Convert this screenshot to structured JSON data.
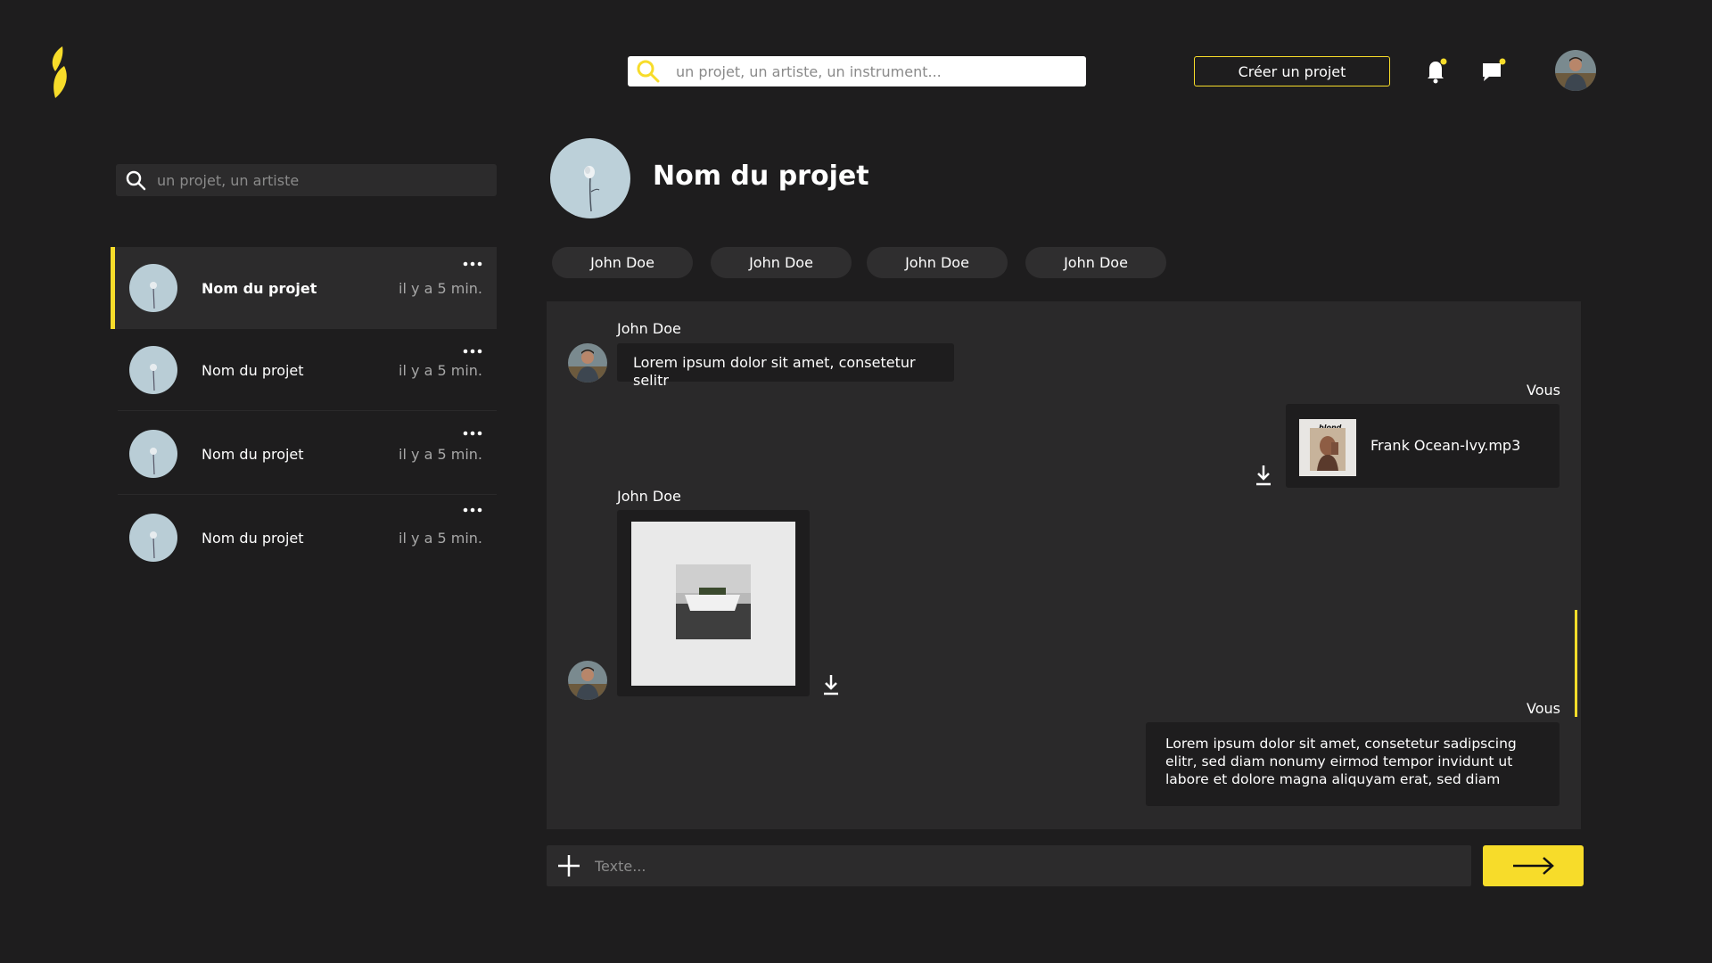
{
  "header": {
    "search_placeholder": "un projet, un artiste, un instrument...",
    "create_label": "Créer un projet"
  },
  "sidebar": {
    "search_placeholder": "un projet, un artiste",
    "items": [
      {
        "name": "Nom du projet",
        "time": "il y a 5 min.",
        "active": true
      },
      {
        "name": "Nom du projet",
        "time": "il y a 5 min.",
        "active": false
      },
      {
        "name": "Nom du projet",
        "time": "il y a 5 min.",
        "active": false
      },
      {
        "name": "Nom du projet",
        "time": "il y a 5 min.",
        "active": false
      }
    ]
  },
  "project": {
    "title": "Nom du projet",
    "members": [
      "John Doe",
      "John Doe",
      "John Doe",
      "John Doe"
    ]
  },
  "chat": {
    "messages": [
      {
        "sender": "John Doe",
        "text": "Lorem ipsum dolor sit amet, consetetur selitr"
      },
      {
        "sender": "Vous",
        "file_name": "Frank Ocean-Ivy.mp3",
        "cover_text": "blond"
      },
      {
        "sender": "John Doe",
        "type": "image"
      },
      {
        "sender": "Vous",
        "text": "Lorem ipsum dolor sit amet, consetetur sadipscing elitr, sed diam nonumy eirmod tempor invidunt ut labore et dolore magna aliquyam erat, sed diam"
      }
    ]
  },
  "composer": {
    "placeholder": "Texte..."
  },
  "colors": {
    "background": "#1e1d1e",
    "panel": "#2a292a",
    "accent": "#f7dc2a"
  },
  "icons": [
    "logo-icon",
    "search-icon",
    "bell-icon",
    "message-icon",
    "more-icon",
    "download-icon",
    "plus-icon",
    "arrow-right-icon"
  ]
}
